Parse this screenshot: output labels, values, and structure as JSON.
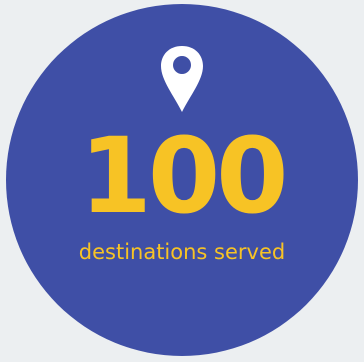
{
  "stat": {
    "number": "100",
    "caption": "destinations served",
    "icon": "map-pin-icon"
  },
  "colors": {
    "background": "#eceff1",
    "circle": "#3f4fa6",
    "accent": "#f7c325",
    "icon": "#ffffff"
  }
}
